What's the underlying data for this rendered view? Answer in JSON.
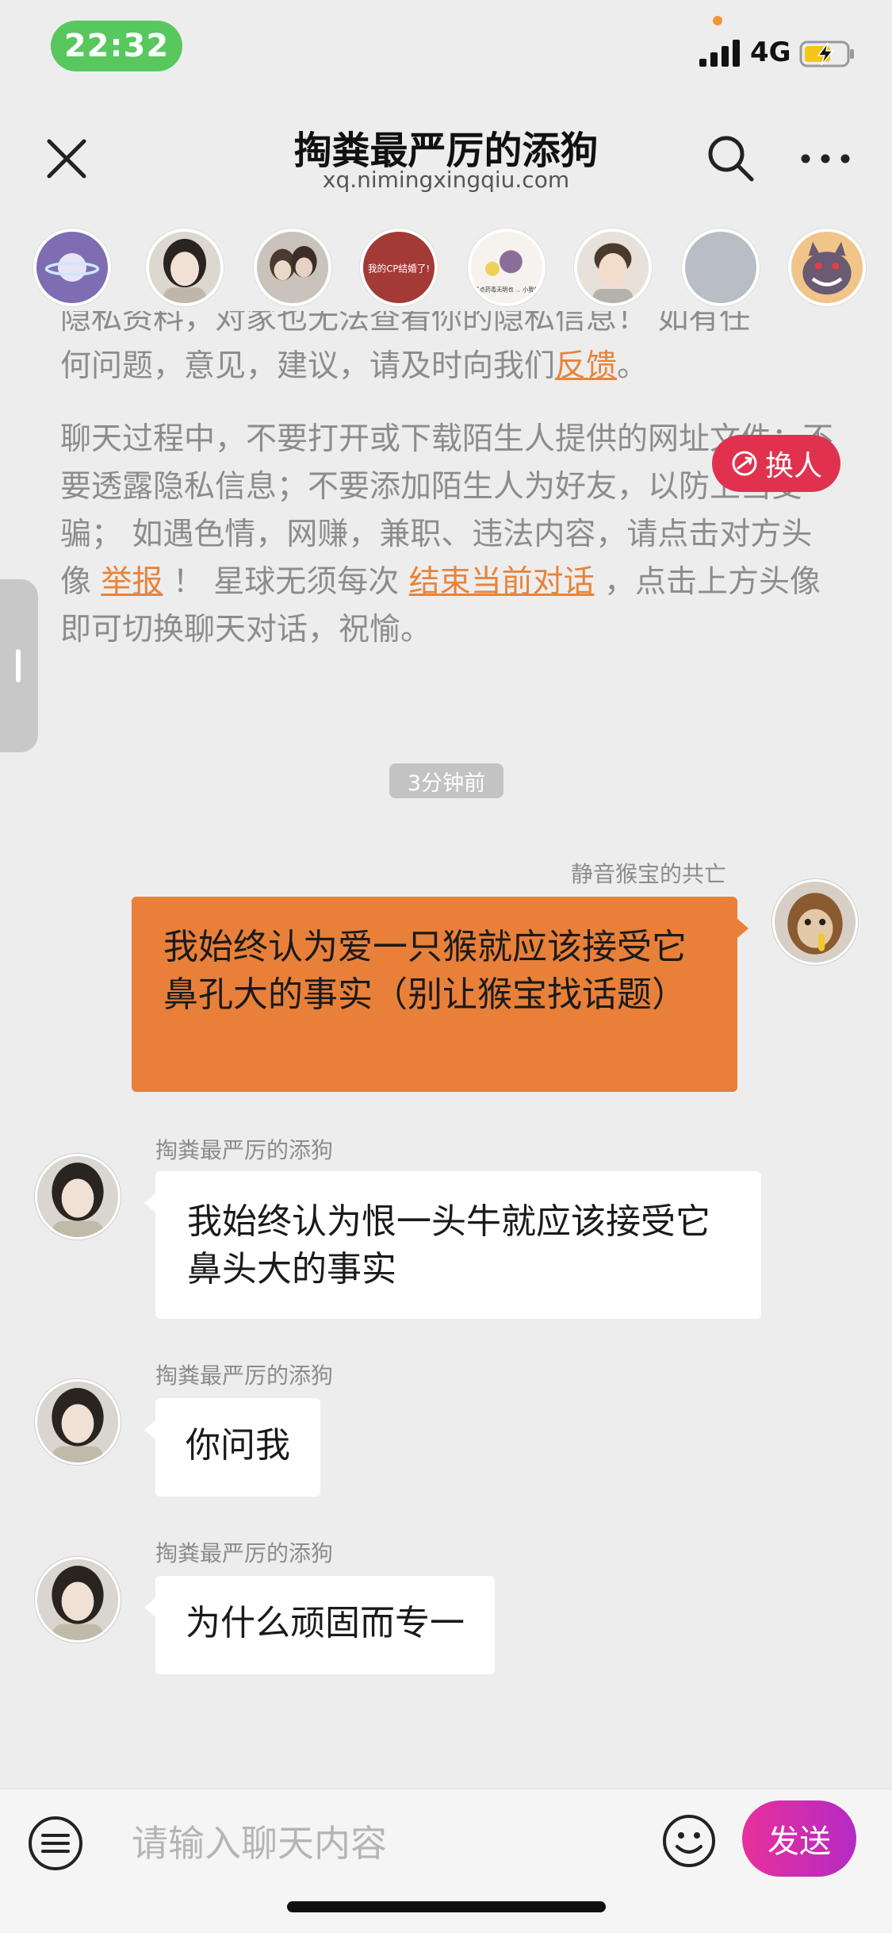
{
  "status_bar": {
    "time": "22:32",
    "network": "4G",
    "colors": {
      "time_pill": "#57c75e",
      "battery": "#f5c518"
    }
  },
  "header": {
    "title": "掏粪最严厉的添狗",
    "subtitle": "xq.nimingxingqiu.com",
    "icons": [
      "close-icon",
      "search-icon",
      "more-icon"
    ]
  },
  "notice": {
    "p1_line_a": "隐私资料，对家也无法查看你的隐私信息！ 如有任",
    "p1_line_b": "何问题，意见，建议，请及时向我们",
    "feedback_link": "反馈",
    "p1_end": "。",
    "p2_text_a": "聊天过程中，不要打开或下载陌生人提供的网址文件；不要透露隐私信息；不要添加陌生人为好友，以防上当受骗； 如遇色情，网赚，兼职、违法内容，请点击对方头像 ",
    "report_link": "举报",
    "p2_text_b": " ！  星球无须每次 ",
    "end_link": "结束当前对话",
    "p2_text_c": " ，点击上方头像即可切换聊天对话，祝愉。"
  },
  "switch_button": {
    "label": "换人"
  },
  "time_chip": "3分钟前",
  "messages": [
    {
      "direction": "out",
      "sender": "静音猴宝的共亡",
      "text": "我始终认为爱一只猴就应该接受它鼻孔大的事实（别让猴宝找话题）"
    },
    {
      "direction": "in",
      "sender": "掏粪最严厉的添狗",
      "text": "我始终认为恨一头牛就应该接受它鼻头大的事实"
    },
    {
      "direction": "in",
      "sender": "掏粪最严厉的添狗",
      "text": "你问我"
    },
    {
      "direction": "in",
      "sender": "掏粪最严厉的添狗",
      "text": "为什么顽固而专一"
    }
  ],
  "avatar_strip_images": {
    "avatar_3": "我的CP结婚了!",
    "avatar_4": "去了点药毒无明也 ... 小我的人"
  },
  "input_bar": {
    "placeholder": "请输入聊天内容",
    "send_label": "发送",
    "colors": {
      "send_from": "#e8309b",
      "send_to": "#b52ac4"
    }
  },
  "accent_colors": {
    "outgoing_bubble": "#e8803a",
    "link": "#e8833a",
    "switch_button": "#e0324f"
  }
}
